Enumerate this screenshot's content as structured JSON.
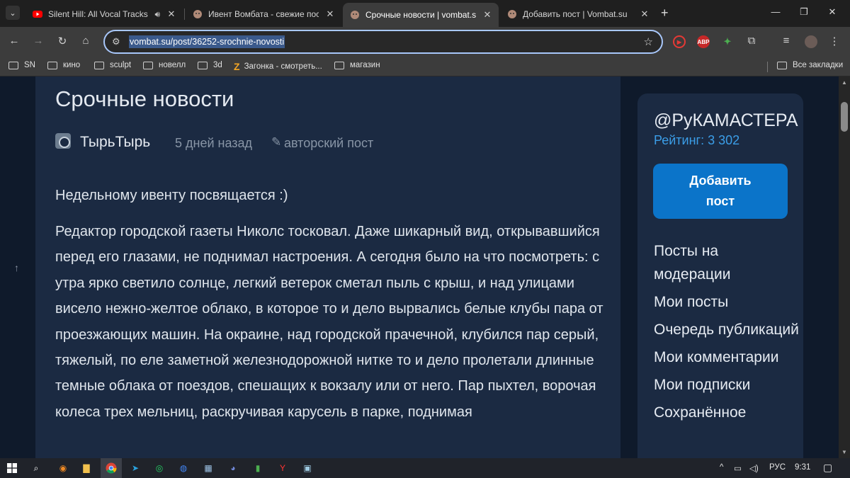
{
  "browser": {
    "tabs": [
      {
        "title": "Silent Hill: All Vocal Tracks -",
        "favicon": "youtube-icon",
        "audio": true,
        "active": false
      },
      {
        "title": "Ивент Вомбата - свежие пост",
        "favicon": "wombat-icon",
        "active": false
      },
      {
        "title": "Срочные новости | vombat.su",
        "favicon": "wombat-icon",
        "active": true
      },
      {
        "title": "Добавить пост | Vombat.su",
        "favicon": "wombat-icon",
        "active": false
      }
    ],
    "new_tab_icon": "+",
    "url": "vombat.su/post/36252-srochnie-novosti",
    "extensions": [
      {
        "name": "record-icon",
        "label": "",
        "color": "#e53935"
      },
      {
        "name": "adblock-icon",
        "label": "ABP",
        "color": "#c62828"
      },
      {
        "name": "puzzle-color-icon",
        "label": "",
        "color": "#43a047"
      }
    ]
  },
  "bookmarks": [
    {
      "label": "SN",
      "type": "folder"
    },
    {
      "label": "кино",
      "type": "folder"
    },
    {
      "label": "sculpt",
      "type": "folder"
    },
    {
      "label": "новелл",
      "type": "folder"
    },
    {
      "label": "3d",
      "type": "folder"
    },
    {
      "label": "Загонка - смотреть...",
      "type": "link"
    },
    {
      "label": "магазин",
      "type": "folder"
    }
  ],
  "all_bookmarks_label": "Все закладки",
  "post": {
    "title": "Срочные новости",
    "author": "ТырьТырь",
    "date": "5 дней назад",
    "type": "авторский пост",
    "intro": "Недельному ивенту посвящается :)",
    "body": "Редактор городской газеты Николс тосковал. Даже шикарный вид, открывавшийся перед его глазами, не поднимал настроения. А сегодня было на что посмотреть: с утра ярко светило солнце, легкий ветерок сметал пыль с крыш, и над улицами висело нежно-желтое облако, в которое то и дело вырвались белые клубы пара от проезжающих машин. На окраине, над городской прачечной, клубился пар серый, тяжелый, по еле заметной железнодорожной нитке то и дело пролетали длинные темные облака от поездов, спешащих к вокзалу или от него. Пар пыхтел, ворочая колеса трех мельниц, раскручивая карусель в парке, поднимая"
  },
  "sidebar": {
    "username": "@РуКАМАСТЕРА",
    "rating": "Рейтинг: 3 302",
    "add_post_line1": "Добавить",
    "add_post_line2": "пост",
    "nav": [
      "Посты на модерации",
      "Мои посты",
      "Очередь публикаций",
      "Мои комментарии",
      "Мои подписки",
      "Сохранённое"
    ]
  },
  "taskbar": {
    "language": "РУС",
    "time": "9:31"
  },
  "colors": {
    "page_bg": "#0f1a2b",
    "card_bg": "#1b2a42",
    "accent_button": "#0b74c9",
    "rating_blue": "#3b9ee8"
  }
}
